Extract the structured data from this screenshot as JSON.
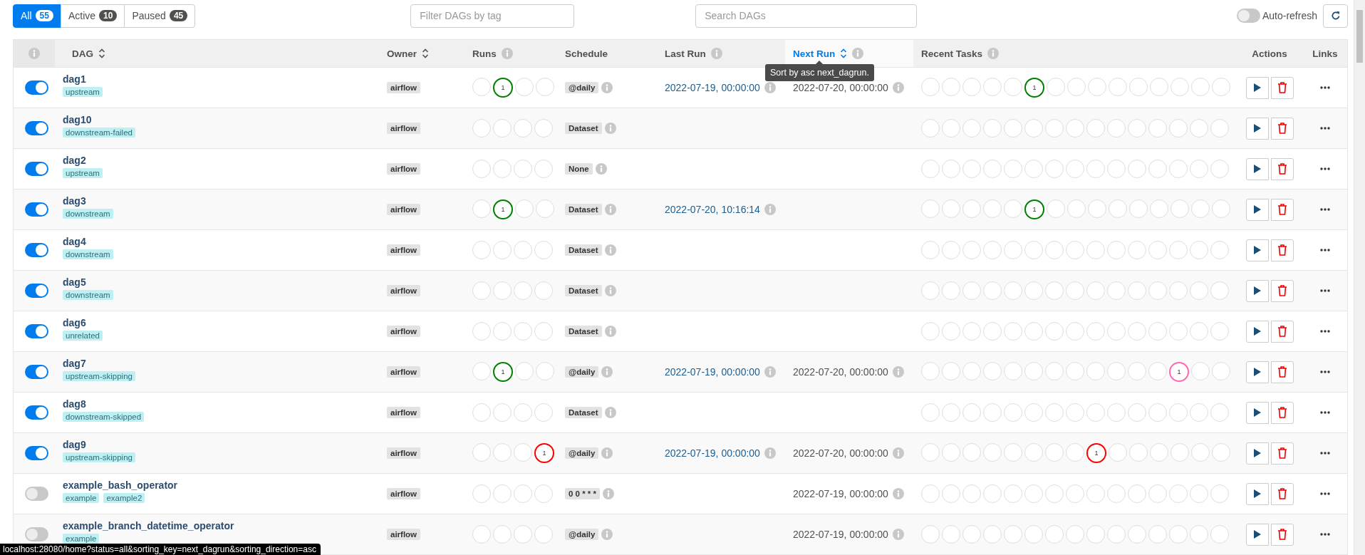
{
  "filters": {
    "tabs": [
      {
        "label": "All",
        "count": "55",
        "selected": true
      },
      {
        "label": "Active",
        "count": "10",
        "selected": false
      },
      {
        "label": "Paused",
        "count": "45",
        "selected": false
      }
    ],
    "tag_filter": {
      "placeholder": "Filter DAGs by tag"
    },
    "search": {
      "placeholder": "Search DAGs"
    },
    "auto_refresh": {
      "label": "Auto-refresh",
      "on": false
    }
  },
  "table": {
    "columns": [
      {
        "label": "DAG",
        "sortable": true,
        "info": false,
        "sorted": false
      },
      {
        "label": "Owner",
        "sortable": true,
        "info": false,
        "sorted": false
      },
      {
        "label": "Runs",
        "sortable": false,
        "info": true,
        "sorted": false
      },
      {
        "label": "Schedule",
        "sortable": false,
        "info": false,
        "sorted": false
      },
      {
        "label": "Last Run",
        "sortable": false,
        "info": true,
        "sorted": false
      },
      {
        "label": "Next Run",
        "sortable": true,
        "info": true,
        "sorted": true,
        "tooltip": "Sort by asc next_dagrun."
      },
      {
        "label": "Recent Tasks",
        "sortable": false,
        "info": true,
        "sorted": false
      },
      {
        "label": "Actions",
        "sortable": false,
        "info": false,
        "sorted": false
      },
      {
        "label": "Links",
        "sortable": false,
        "info": false,
        "sorted": false
      }
    ],
    "rows": [
      {
        "name": "dag1",
        "tags": [
          "upstream"
        ],
        "active": true,
        "owner": "airflow",
        "runs": [
          {
            "color": "#dedede"
          },
          {
            "color": "#008000",
            "count": "1"
          },
          {
            "color": "#dedede"
          },
          {
            "color": "#dedede"
          }
        ],
        "schedule": "@daily",
        "last_run": "2022-07-19, 00:00:00",
        "next_run": "2022-07-20, 00:00:00",
        "recent_tasks": [
          {
            "color": "#dedede"
          },
          {
            "color": "#dedede"
          },
          {
            "color": "#dedede"
          },
          {
            "color": "#dedede"
          },
          {
            "color": "#dedede"
          },
          {
            "color": "#008000",
            "count": "1"
          },
          {
            "color": "#dedede"
          },
          {
            "color": "#dedede"
          },
          {
            "color": "#dedede"
          },
          {
            "color": "#dedede"
          },
          {
            "color": "#dedede"
          },
          {
            "color": "#dedede"
          },
          {
            "color": "#dedede"
          },
          {
            "color": "#dedede"
          },
          {
            "color": "#dedede"
          }
        ]
      },
      {
        "name": "dag10",
        "tags": [
          "downstream-failed"
        ],
        "active": true,
        "owner": "airflow",
        "runs": [
          {
            "color": "#dedede"
          },
          {
            "color": "#dedede"
          },
          {
            "color": "#dedede"
          },
          {
            "color": "#dedede"
          }
        ],
        "schedule": "Dataset",
        "recent_tasks": [
          {
            "color": "#dedede"
          },
          {
            "color": "#dedede"
          },
          {
            "color": "#dedede"
          },
          {
            "color": "#dedede"
          },
          {
            "color": "#dedede"
          },
          {
            "color": "#dedede"
          },
          {
            "color": "#dedede"
          },
          {
            "color": "#dedede"
          },
          {
            "color": "#dedede"
          },
          {
            "color": "#dedede"
          },
          {
            "color": "#dedede"
          },
          {
            "color": "#dedede"
          },
          {
            "color": "#dedede"
          },
          {
            "color": "#dedede"
          },
          {
            "color": "#dedede"
          }
        ]
      },
      {
        "name": "dag2",
        "tags": [
          "upstream"
        ],
        "active": true,
        "owner": "airflow",
        "runs": [
          {
            "color": "#dedede"
          },
          {
            "color": "#dedede"
          },
          {
            "color": "#dedede"
          },
          {
            "color": "#dedede"
          }
        ],
        "schedule": "None",
        "recent_tasks": [
          {
            "color": "#dedede"
          },
          {
            "color": "#dedede"
          },
          {
            "color": "#dedede"
          },
          {
            "color": "#dedede"
          },
          {
            "color": "#dedede"
          },
          {
            "color": "#dedede"
          },
          {
            "color": "#dedede"
          },
          {
            "color": "#dedede"
          },
          {
            "color": "#dedede"
          },
          {
            "color": "#dedede"
          },
          {
            "color": "#dedede"
          },
          {
            "color": "#dedede"
          },
          {
            "color": "#dedede"
          },
          {
            "color": "#dedede"
          },
          {
            "color": "#dedede"
          }
        ]
      },
      {
        "name": "dag3",
        "tags": [
          "downstream"
        ],
        "active": true,
        "owner": "airflow",
        "runs": [
          {
            "color": "#dedede"
          },
          {
            "color": "#008000",
            "count": "1"
          },
          {
            "color": "#dedede"
          },
          {
            "color": "#dedede"
          }
        ],
        "schedule": "Dataset",
        "last_run": "2022-07-20, 10:16:14",
        "recent_tasks": [
          {
            "color": "#dedede"
          },
          {
            "color": "#dedede"
          },
          {
            "color": "#dedede"
          },
          {
            "color": "#dedede"
          },
          {
            "color": "#dedede"
          },
          {
            "color": "#008000",
            "count": "1"
          },
          {
            "color": "#dedede"
          },
          {
            "color": "#dedede"
          },
          {
            "color": "#dedede"
          },
          {
            "color": "#dedede"
          },
          {
            "color": "#dedede"
          },
          {
            "color": "#dedede"
          },
          {
            "color": "#dedede"
          },
          {
            "color": "#dedede"
          },
          {
            "color": "#dedede"
          }
        ]
      },
      {
        "name": "dag4",
        "tags": [
          "downstream"
        ],
        "active": true,
        "owner": "airflow",
        "runs": [
          {
            "color": "#dedede"
          },
          {
            "color": "#dedede"
          },
          {
            "color": "#dedede"
          },
          {
            "color": "#dedede"
          }
        ],
        "schedule": "Dataset",
        "recent_tasks": [
          {
            "color": "#dedede"
          },
          {
            "color": "#dedede"
          },
          {
            "color": "#dedede"
          },
          {
            "color": "#dedede"
          },
          {
            "color": "#dedede"
          },
          {
            "color": "#dedede"
          },
          {
            "color": "#dedede"
          },
          {
            "color": "#dedede"
          },
          {
            "color": "#dedede"
          },
          {
            "color": "#dedede"
          },
          {
            "color": "#dedede"
          },
          {
            "color": "#dedede"
          },
          {
            "color": "#dedede"
          },
          {
            "color": "#dedede"
          },
          {
            "color": "#dedede"
          }
        ]
      },
      {
        "name": "dag5",
        "tags": [
          "downstream"
        ],
        "active": true,
        "owner": "airflow",
        "runs": [
          {
            "color": "#dedede"
          },
          {
            "color": "#dedede"
          },
          {
            "color": "#dedede"
          },
          {
            "color": "#dedede"
          }
        ],
        "schedule": "Dataset",
        "recent_tasks": [
          {
            "color": "#dedede"
          },
          {
            "color": "#dedede"
          },
          {
            "color": "#dedede"
          },
          {
            "color": "#dedede"
          },
          {
            "color": "#dedede"
          },
          {
            "color": "#dedede"
          },
          {
            "color": "#dedede"
          },
          {
            "color": "#dedede"
          },
          {
            "color": "#dedede"
          },
          {
            "color": "#dedede"
          },
          {
            "color": "#dedede"
          },
          {
            "color": "#dedede"
          },
          {
            "color": "#dedede"
          },
          {
            "color": "#dedede"
          },
          {
            "color": "#dedede"
          }
        ]
      },
      {
        "name": "dag6",
        "tags": [
          "unrelated"
        ],
        "active": true,
        "owner": "airflow",
        "runs": [
          {
            "color": "#dedede"
          },
          {
            "color": "#dedede"
          },
          {
            "color": "#dedede"
          },
          {
            "color": "#dedede"
          }
        ],
        "schedule": "Dataset",
        "recent_tasks": [
          {
            "color": "#dedede"
          },
          {
            "color": "#dedede"
          },
          {
            "color": "#dedede"
          },
          {
            "color": "#dedede"
          },
          {
            "color": "#dedede"
          },
          {
            "color": "#dedede"
          },
          {
            "color": "#dedede"
          },
          {
            "color": "#dedede"
          },
          {
            "color": "#dedede"
          },
          {
            "color": "#dedede"
          },
          {
            "color": "#dedede"
          },
          {
            "color": "#dedede"
          },
          {
            "color": "#dedede"
          },
          {
            "color": "#dedede"
          },
          {
            "color": "#dedede"
          }
        ]
      },
      {
        "name": "dag7",
        "tags": [
          "upstream-skipping"
        ],
        "active": true,
        "owner": "airflow",
        "runs": [
          {
            "color": "#dedede"
          },
          {
            "color": "#008000",
            "count": "1"
          },
          {
            "color": "#dedede"
          },
          {
            "color": "#dedede"
          }
        ],
        "schedule": "@daily",
        "last_run": "2022-07-19, 00:00:00",
        "next_run": "2022-07-20, 00:00:00",
        "recent_tasks": [
          {
            "color": "#dedede"
          },
          {
            "color": "#dedede"
          },
          {
            "color": "#dedede"
          },
          {
            "color": "#dedede"
          },
          {
            "color": "#dedede"
          },
          {
            "color": "#dedede"
          },
          {
            "color": "#dedede"
          },
          {
            "color": "#dedede"
          },
          {
            "color": "#dedede"
          },
          {
            "color": "#dedede"
          },
          {
            "color": "#dedede"
          },
          {
            "color": "#dedede"
          },
          {
            "color": "#ff69b4",
            "count": "1"
          },
          {
            "color": "#dedede"
          },
          {
            "color": "#dedede"
          }
        ]
      },
      {
        "name": "dag8",
        "tags": [
          "downstream-skipped"
        ],
        "active": true,
        "owner": "airflow",
        "runs": [
          {
            "color": "#dedede"
          },
          {
            "color": "#dedede"
          },
          {
            "color": "#dedede"
          },
          {
            "color": "#dedede"
          }
        ],
        "schedule": "Dataset",
        "recent_tasks": [
          {
            "color": "#dedede"
          },
          {
            "color": "#dedede"
          },
          {
            "color": "#dedede"
          },
          {
            "color": "#dedede"
          },
          {
            "color": "#dedede"
          },
          {
            "color": "#dedede"
          },
          {
            "color": "#dedede"
          },
          {
            "color": "#dedede"
          },
          {
            "color": "#dedede"
          },
          {
            "color": "#dedede"
          },
          {
            "color": "#dedede"
          },
          {
            "color": "#dedede"
          },
          {
            "color": "#dedede"
          },
          {
            "color": "#dedede"
          },
          {
            "color": "#dedede"
          }
        ]
      },
      {
        "name": "dag9",
        "tags": [
          "upstream-skipping"
        ],
        "active": true,
        "owner": "airflow",
        "runs": [
          {
            "color": "#dedede"
          },
          {
            "color": "#dedede"
          },
          {
            "color": "#dedede"
          },
          {
            "color": "#ff0000",
            "count": "1"
          }
        ],
        "schedule": "@daily",
        "last_run": "2022-07-19, 00:00:00",
        "next_run": "2022-07-20, 00:00:00",
        "recent_tasks": [
          {
            "color": "#dedede"
          },
          {
            "color": "#dedede"
          },
          {
            "color": "#dedede"
          },
          {
            "color": "#dedede"
          },
          {
            "color": "#dedede"
          },
          {
            "color": "#dedede"
          },
          {
            "color": "#dedede"
          },
          {
            "color": "#dedede"
          },
          {
            "color": "#ff0000",
            "count": "1"
          },
          {
            "color": "#dedede"
          },
          {
            "color": "#dedede"
          },
          {
            "color": "#dedede"
          },
          {
            "color": "#dedede"
          },
          {
            "color": "#dedede"
          },
          {
            "color": "#dedede"
          }
        ]
      },
      {
        "name": "example_bash_operator",
        "tags": [
          "example",
          "example2"
        ],
        "active": false,
        "owner": "airflow",
        "runs": [
          {
            "color": "#dedede"
          },
          {
            "color": "#dedede"
          },
          {
            "color": "#dedede"
          },
          {
            "color": "#dedede"
          }
        ],
        "schedule": "0 0 * * *",
        "next_run": "2022-07-19, 00:00:00",
        "recent_tasks": [
          {
            "color": "#dedede"
          },
          {
            "color": "#dedede"
          },
          {
            "color": "#dedede"
          },
          {
            "color": "#dedede"
          },
          {
            "color": "#dedede"
          },
          {
            "color": "#dedede"
          },
          {
            "color": "#dedede"
          },
          {
            "color": "#dedede"
          },
          {
            "color": "#dedede"
          },
          {
            "color": "#dedede"
          },
          {
            "color": "#dedede"
          },
          {
            "color": "#dedede"
          },
          {
            "color": "#dedede"
          },
          {
            "color": "#dedede"
          },
          {
            "color": "#dedede"
          }
        ]
      },
      {
        "name": "example_branch_datetime_operator",
        "tags": [
          "example"
        ],
        "active": false,
        "owner": "airflow",
        "runs": [
          {
            "color": "#dedede"
          },
          {
            "color": "#dedede"
          },
          {
            "color": "#dedede"
          },
          {
            "color": "#dedede"
          }
        ],
        "schedule": "@daily",
        "next_run": "2022-07-19, 00:00:00",
        "recent_tasks": [
          {
            "color": "#dedede"
          },
          {
            "color": "#dedede"
          },
          {
            "color": "#dedede"
          },
          {
            "color": "#dedede"
          },
          {
            "color": "#dedede"
          },
          {
            "color": "#dedede"
          },
          {
            "color": "#dedede"
          },
          {
            "color": "#dedede"
          },
          {
            "color": "#dedede"
          },
          {
            "color": "#dedede"
          },
          {
            "color": "#dedede"
          },
          {
            "color": "#dedede"
          },
          {
            "color": "#dedede"
          },
          {
            "color": "#dedede"
          },
          {
            "color": "#dedede"
          }
        ]
      }
    ]
  },
  "status_bar": {
    "url": "localhost:28080/home?status=all&sorting_key=next_dagrun&sorting_direction=asc"
  }
}
